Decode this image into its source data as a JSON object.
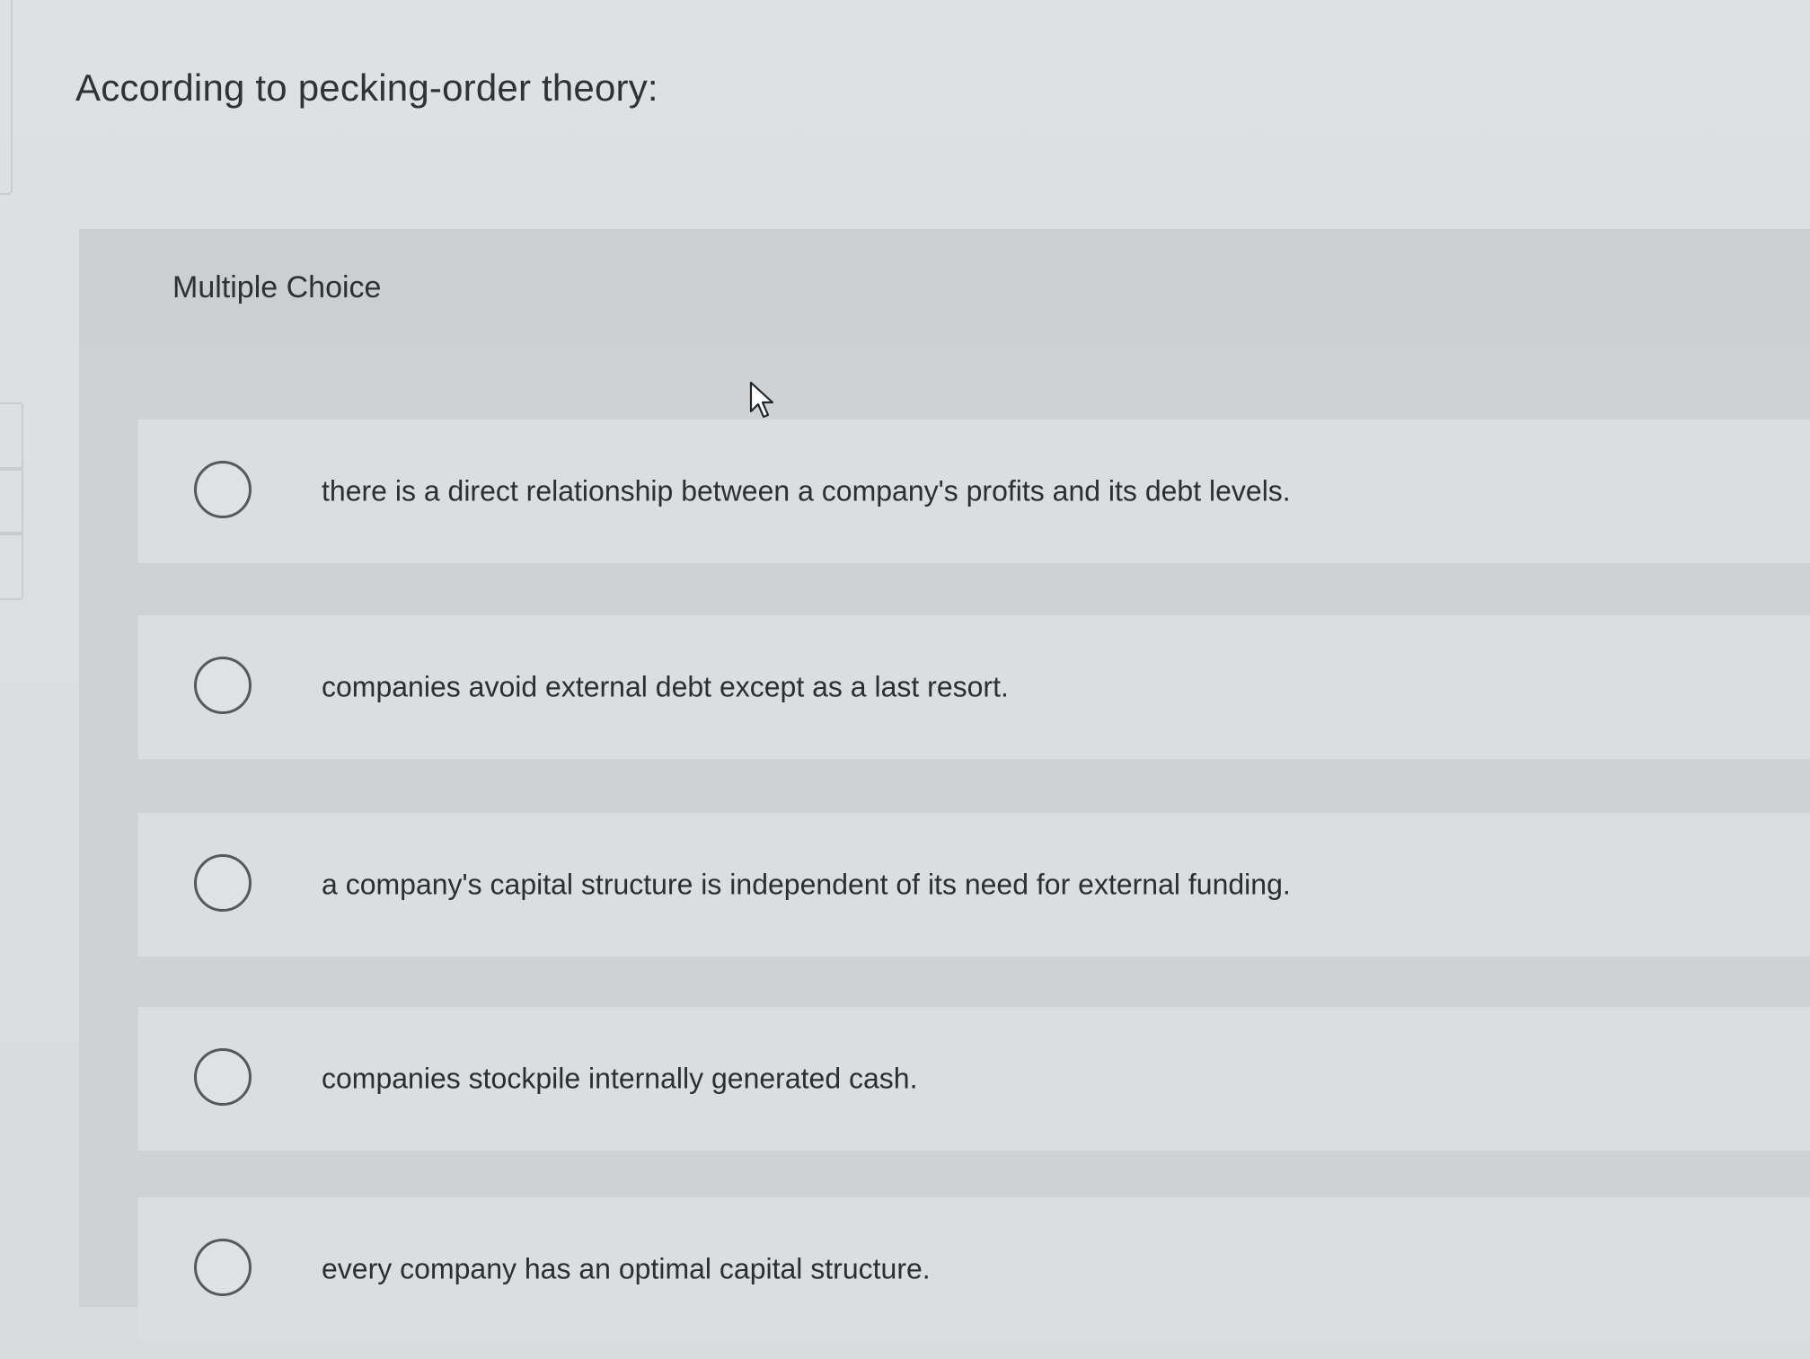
{
  "question": {
    "text": "According to pecking-order theory:"
  },
  "panel": {
    "label": "Multiple Choice"
  },
  "choices": [
    {
      "text": "there is a direct relationship between a company's profits and its debt levels."
    },
    {
      "text": "companies avoid external debt except as a last resort."
    },
    {
      "text": "a company's capital structure is independent of its need for external funding."
    },
    {
      "text": "companies stockpile internally generated cash."
    },
    {
      "text": "every company has an optimal capital structure."
    }
  ],
  "icons": {
    "radio": "radio-unchecked-icon",
    "cursor": "mouse-pointer-icon"
  }
}
